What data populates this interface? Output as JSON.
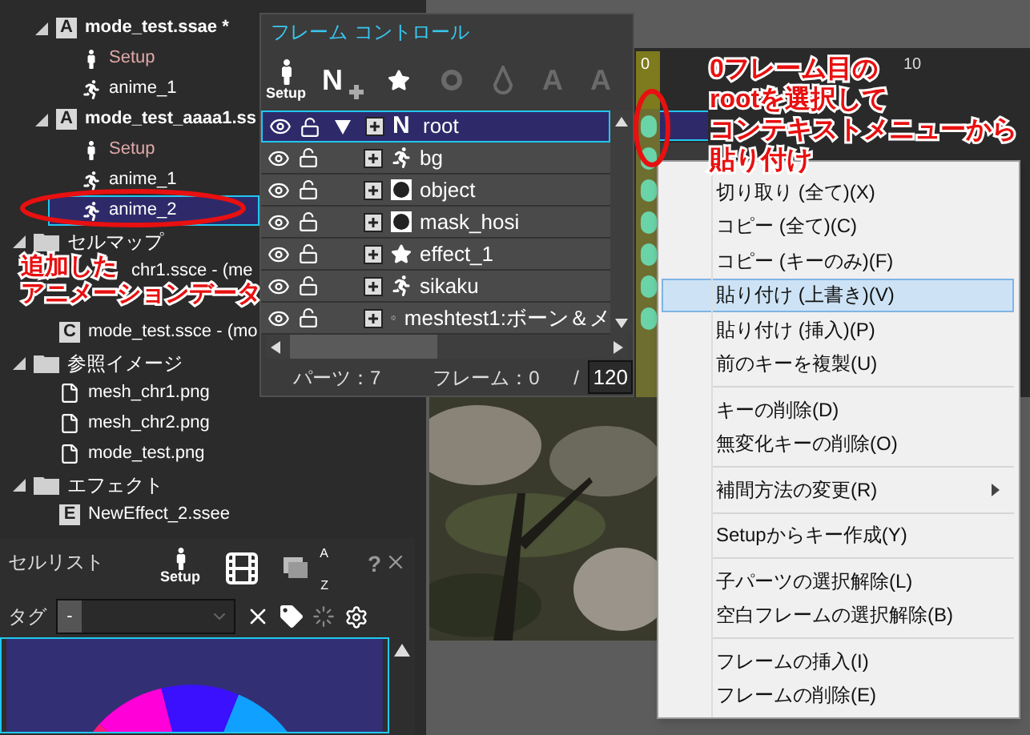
{
  "project_tree": {
    "animations": [
      {
        "badge": "A",
        "label": "mode_test.ssae *",
        "expanded": true,
        "children": [
          {
            "kind": "setup",
            "label": "Setup",
            "selected": false
          },
          {
            "kind": "anime",
            "label": "anime_1",
            "selected": false
          }
        ]
      },
      {
        "badge": "A",
        "label": "mode_test_aaaa1.ss",
        "expanded": true,
        "children": [
          {
            "kind": "setup",
            "label": "Setup",
            "selected": false
          },
          {
            "kind": "anime",
            "label": "anime_1",
            "selected": false
          },
          {
            "kind": "anime",
            "label": "anime_2",
            "selected": true
          }
        ]
      }
    ],
    "folders": [
      {
        "label": "セルマップ",
        "expanded": true,
        "children": [
          {
            "kind": "partial",
            "label": "chr1.ssce - (me"
          },
          {
            "kind": "file",
            "badge": "C",
            "label": "mode_test.ssce - (mo"
          }
        ]
      },
      {
        "label": "参照イメージ",
        "expanded": true,
        "children": [
          {
            "label": "mesh_chr1.png"
          },
          {
            "label": "mesh_chr2.png"
          },
          {
            "label": "mode_test.png"
          }
        ]
      },
      {
        "label": "エフェクト",
        "expanded": true,
        "children": [
          {
            "kind": "file",
            "badge": "E",
            "label": "NewEffect_2.ssee"
          }
        ]
      }
    ]
  },
  "frame_control": {
    "title": "フレーム コントロール",
    "toolbar": [
      {
        "kind": "setup",
        "label": "Setup",
        "disabled": false
      },
      {
        "kind": "add_null",
        "glyph": "N",
        "disabled": false
      },
      {
        "kind": "add_star",
        "disabled": false
      },
      {
        "kind": "add_circle",
        "disabled": true
      },
      {
        "kind": "add_drop",
        "disabled": true
      },
      {
        "kind": "undo_a",
        "glyph": "A",
        "disabled": true
      },
      {
        "kind": "redo_a",
        "glyph": "A",
        "disabled": true
      }
    ],
    "parts": [
      {
        "kind": "null",
        "glyph": "N",
        "label": "root",
        "selected": true,
        "expanded": true
      },
      {
        "kind": "anime",
        "label": "bg",
        "selected": false
      },
      {
        "kind": "mask",
        "label": "object",
        "selected": false
      },
      {
        "kind": "mask",
        "label": "mask_hosi",
        "selected": false
      },
      {
        "kind": "effect",
        "label": "effect_1",
        "selected": false
      },
      {
        "kind": "anime",
        "label": "sikaku",
        "selected": false
      },
      {
        "kind": "mesh",
        "label": "meshtest1:ボーン＆メ",
        "selected": false
      }
    ],
    "parts_label": "パーツ：",
    "parts_count": "7",
    "frame_label": "フレーム：",
    "frame_value": "0",
    "slash": "/",
    "end_frame": "120"
  },
  "timeline": {
    "current_frame": "0",
    "tick_label": "10"
  },
  "context_menu": [
    {
      "kind": "item",
      "label": "切り取り (全て)(X)",
      "selected": false
    },
    {
      "kind": "item",
      "label": "コピー (全て)(C)",
      "selected": false
    },
    {
      "kind": "item",
      "label": "コピー (キーのみ)(F)",
      "selected": false
    },
    {
      "kind": "item",
      "label": "貼り付け (上書き)(V)",
      "selected": true
    },
    {
      "kind": "item",
      "label": "貼り付け (挿入)(P)",
      "selected": false
    },
    {
      "kind": "item",
      "label": "前のキーを複製(U)",
      "selected": false
    },
    {
      "kind": "separator"
    },
    {
      "kind": "item",
      "label": "キーの削除(D)",
      "selected": false
    },
    {
      "kind": "item",
      "label": "無変化キーの削除(O)",
      "selected": false
    },
    {
      "kind": "separator"
    },
    {
      "kind": "submenu",
      "label": "補間方法の変更(R)",
      "selected": false
    },
    {
      "kind": "separator"
    },
    {
      "kind": "item",
      "label": "Setupからキー作成(Y)",
      "selected": false
    },
    {
      "kind": "separator"
    },
    {
      "kind": "item",
      "label": "子パーツの選択解除(L)",
      "selected": false
    },
    {
      "kind": "item",
      "label": "空白フレームの選択解除(B)",
      "selected": false
    },
    {
      "kind": "separator"
    },
    {
      "kind": "item",
      "label": "フレームの挿入(I)",
      "selected": false
    },
    {
      "kind": "item",
      "label": "フレームの削除(E)",
      "selected": false
    }
  ],
  "cell_list": {
    "title": "セルリスト",
    "setup_label": "Setup",
    "sort_a": "A",
    "sort_z": "Z",
    "help": "?",
    "tag_label": "タグ",
    "tag_button": "-"
  },
  "annotations": [
    {
      "lines": [
        "0フレーム目の",
        "rootを選択して",
        "コンテキストメニューから",
        "貼り付け"
      ]
    },
    {
      "lines": [
        "追加した",
        "アニメーションデータ"
      ]
    }
  ]
}
